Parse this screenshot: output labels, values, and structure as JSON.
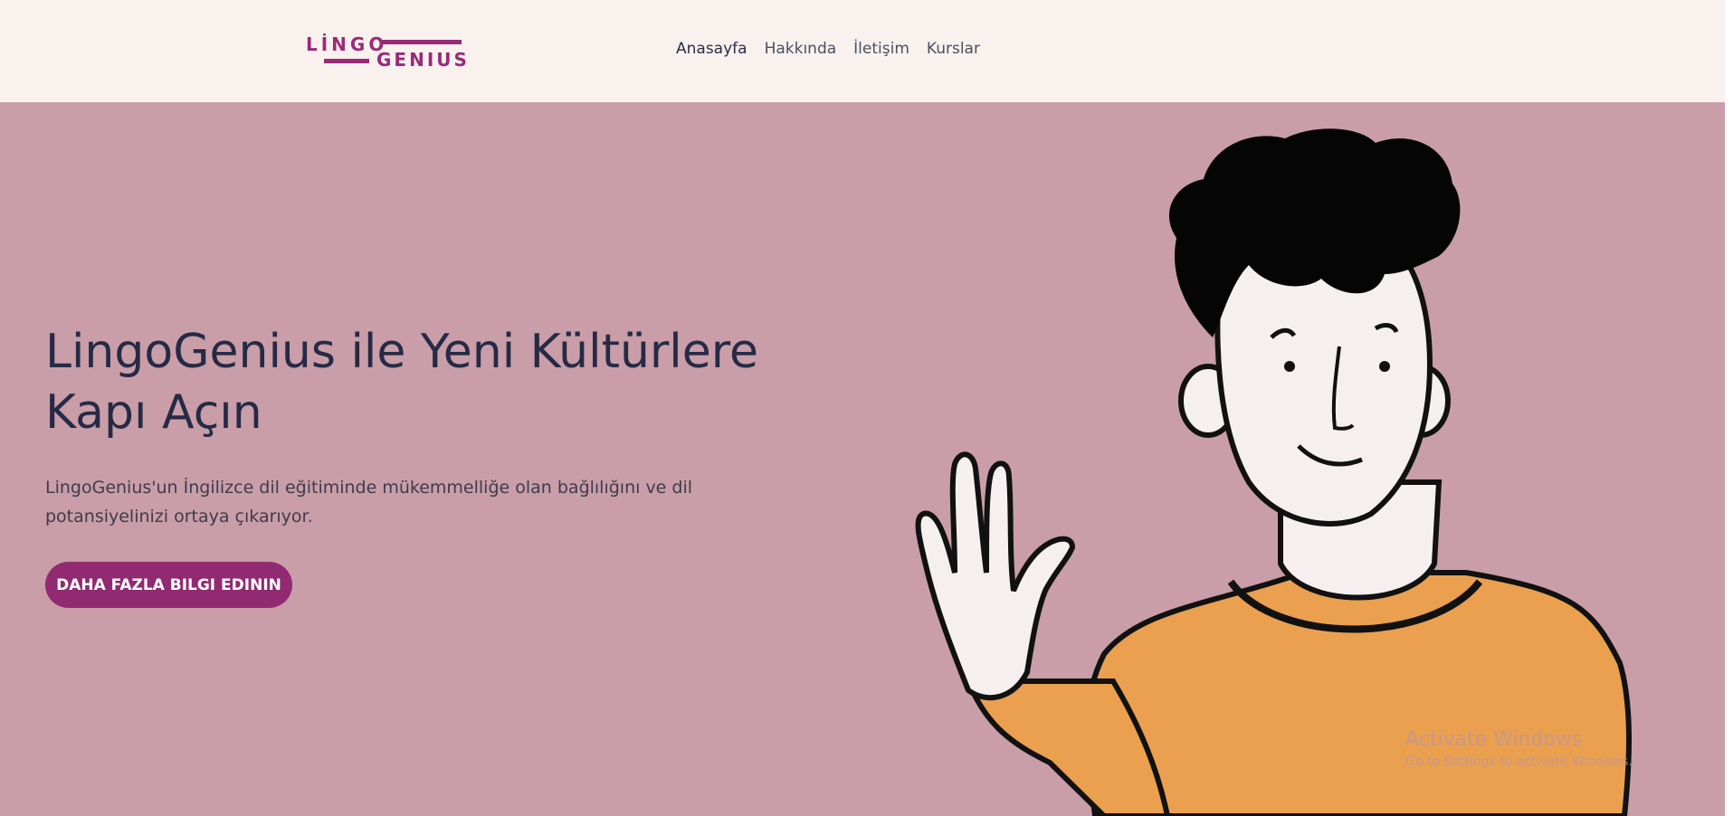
{
  "brand": {
    "logo_top": "LİNGO",
    "logo_bottom": "GENIUS",
    "accent_color": "#922a72"
  },
  "nav": {
    "items": [
      {
        "label": "Anasayfa",
        "active": true
      },
      {
        "label": "Hakkında",
        "active": false
      },
      {
        "label": "İletişim",
        "active": false
      },
      {
        "label": "Kurslar",
        "active": false
      }
    ]
  },
  "hero": {
    "title": "LingoGenius ile Yeni Kültürlere Kapı Açın",
    "subtitle": "LingoGenius'un İngilizce dil eğitiminde mükemmelliğe olan bağlılığını ve dil potansiyelinizi ortaya çıkarıyor.",
    "cta_label": "DAHA FAZLA BILGI EDININ",
    "background_color": "#c99ea8",
    "illustration": "waving-man-illustration"
  },
  "watermark": {
    "title": "Activate Windows",
    "subtitle": "Go to Settings to activate Windows."
  }
}
